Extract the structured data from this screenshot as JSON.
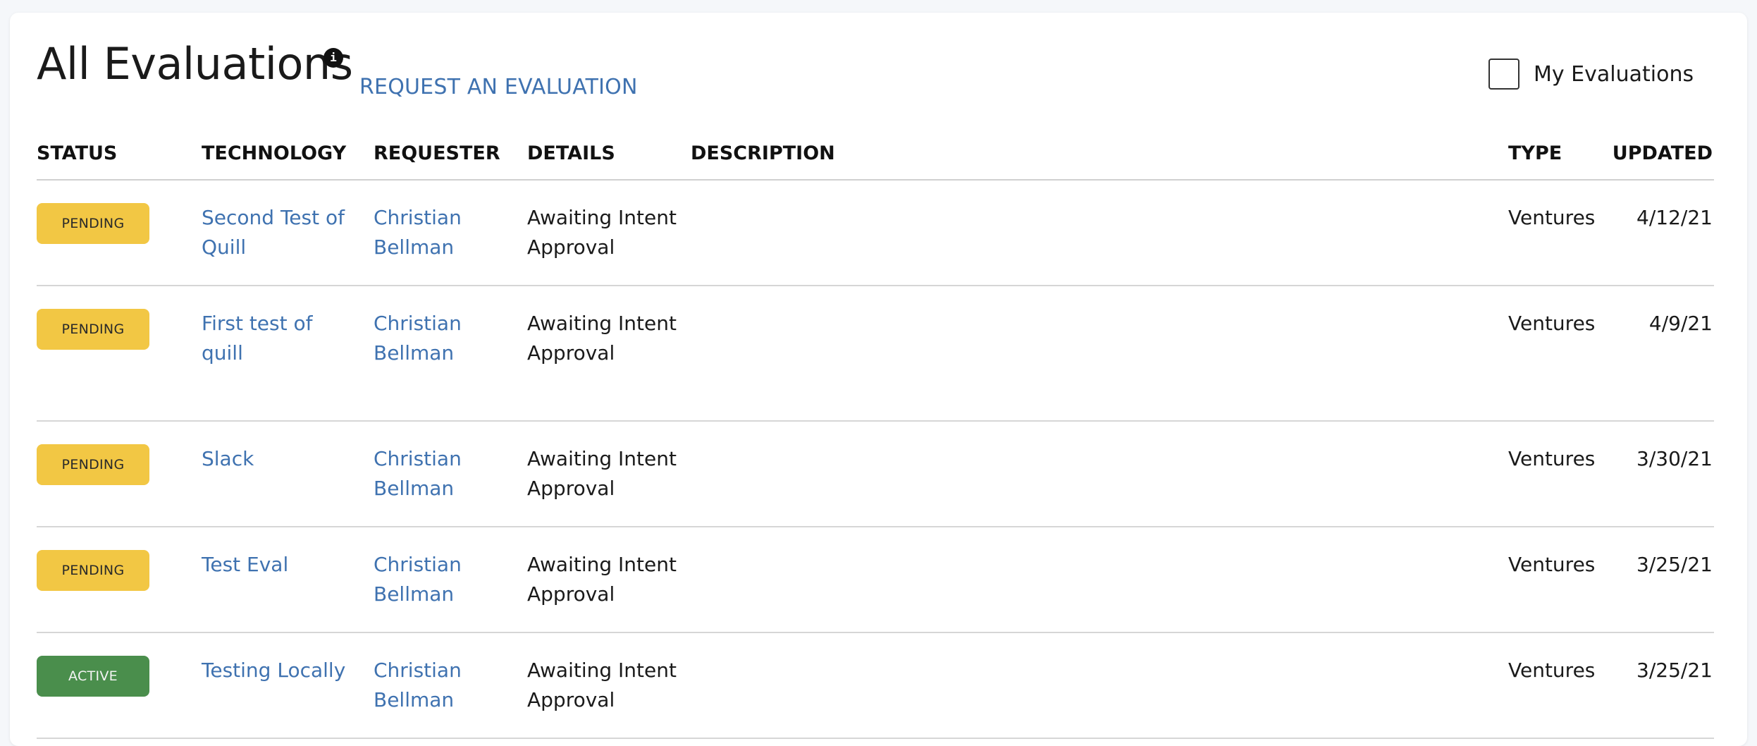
{
  "page": {
    "title": "All Evaluations",
    "info_icon_glyph": "i",
    "request_link": "REQUEST AN EVALUATION",
    "my_evaluations_label": "My Evaluations",
    "my_evaluations_checked": false
  },
  "table": {
    "headers": {
      "status": "STATUS",
      "technology": "TECHNOLOGY",
      "requester": "REQUESTER",
      "details": "DETAILS",
      "description": "DESCRIPTION",
      "type": "TYPE",
      "updated": "UPDATED"
    },
    "rows": [
      {
        "status": "PENDING",
        "technology": "Second Test of Quill",
        "requester": "Christian Bellman",
        "details": "Awaiting Intent Approval",
        "description": "",
        "type": "Ventures",
        "updated": "4/12/21"
      },
      {
        "status": "PENDING",
        "technology": "First test of quill",
        "requester": "Christian Bellman",
        "details": "Awaiting Intent Approval",
        "description": "",
        "type": "Ventures",
        "updated": "4/9/21"
      },
      {
        "status": "PENDING",
        "technology": "Slack",
        "requester": "Christian Bellman",
        "details": "Awaiting Intent Approval",
        "description": "",
        "type": "Ventures",
        "updated": "3/30/21"
      },
      {
        "status": "PENDING",
        "technology": "Test Eval",
        "requester": "Christian Bellman",
        "details": "Awaiting Intent Approval",
        "description": "",
        "type": "Ventures",
        "updated": "3/25/21"
      },
      {
        "status": "ACTIVE",
        "technology": "Testing Locally",
        "requester": "Christian Bellman",
        "details": "Awaiting Intent Approval",
        "description": "",
        "type": "Ventures",
        "updated": "3/25/21"
      }
    ]
  },
  "colors": {
    "link": "#3f72b0",
    "pending_badge": "#f2c744",
    "active_badge": "#4a8e4c"
  }
}
